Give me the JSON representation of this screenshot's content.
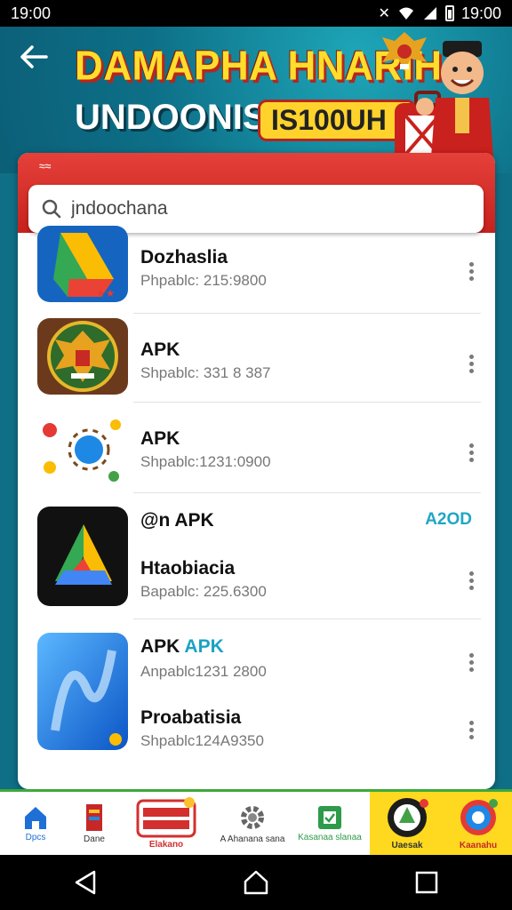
{
  "status_bar": {
    "time_left": "19:00",
    "time_right": "19:00"
  },
  "hero": {
    "title_line1": "DAMAPHA HNARIH",
    "title_line2": "UNDOONISIA",
    "badge": "IS100UH I"
  },
  "card": {
    "header_marks": "≈≈",
    "search": {
      "value": "jndoochana",
      "placeholder": "jndoochana"
    }
  },
  "apps": [
    {
      "name": "Dozhaslia",
      "subtitle": "Phpablc: 215:9800",
      "icon": "drive-style-icon"
    },
    {
      "name": "APK",
      "subtitle": "Shpablc: 331 8 387",
      "icon": "garuda-emblem-icon"
    },
    {
      "name": "APK",
      "subtitle": "Shpablc:1231:0900",
      "icon": "settings-hub-icon"
    },
    {
      "name": "@n APK",
      "action": "A2OD",
      "name2": "Htaobiacia",
      "subtitle": "Bapablc: 225.6300",
      "icon": "triangle-drive-icon"
    },
    {
      "name": "APK",
      "name_extra": "APK",
      "subtitle": "Anpablc1231 2800",
      "name2": "Proabatisia",
      "subtitle2": "Shpablc124A9350",
      "icon": "blue-wave-icon"
    }
  ],
  "bottom_strip": [
    {
      "label": "Dpcs",
      "icon": "home-icon"
    },
    {
      "label": "Dane",
      "icon": "book-icon"
    },
    {
      "label": "Elakano",
      "icon": "promo-badge-icon"
    },
    {
      "label": "A Ahanana sana",
      "icon": "gear-icon"
    },
    {
      "label": "Kasanaa slanaa",
      "icon": "green-doc-icon"
    },
    {
      "label": "Uaesak",
      "icon": "emblem-badge-icon"
    },
    {
      "label": "Kaanahu",
      "icon": "colorful-badge-icon"
    }
  ],
  "colors": {
    "header_red": "#d62d27",
    "accent_teal": "#1aa3c3",
    "title_yellow": "#ffdd2b"
  }
}
